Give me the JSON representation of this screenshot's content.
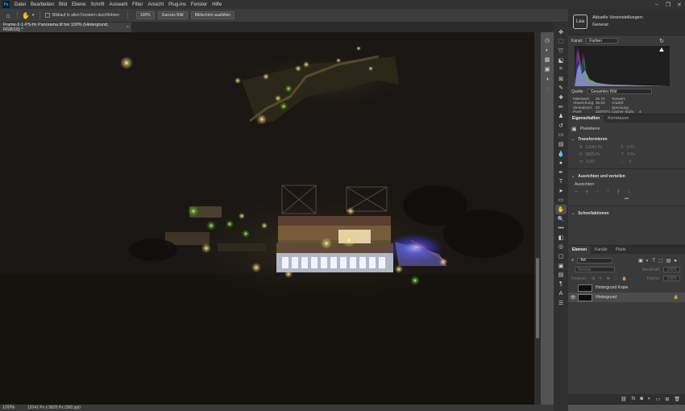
{
  "app": {
    "logo": "Ps"
  },
  "menu": [
    "Datei",
    "Bearbeiten",
    "Bild",
    "Ebene",
    "Schrift",
    "Auswahl",
    "Filter",
    "Ansicht",
    "Plug-ins",
    "Fenster",
    "Hilfe"
  ],
  "window_controls": [
    "–",
    "❐",
    "✕"
  ],
  "options": {
    "scroll_all_label": "Bildlauf in allen Fenstern durchführen",
    "zoom_btn": "100%",
    "fit_btn": "Ganzes Bild",
    "fill_btn": "Bildschirm ausfüllen"
  },
  "document_tab": {
    "title": "Frame-2-1-PS-fin Panorama.tif bei 100% (Hintergrund, RGB/16) *",
    "close": "×"
  },
  "status": {
    "zoom": "100%",
    "info": "12041 Px x 5825 Px (300 ppi)"
  },
  "learn_panel": {
    "line1": "Aktuelle Voreinstellungen:",
    "line2": "General",
    "icon": "Lea"
  },
  "histogram": {
    "kanal_label": "Kanal:",
    "kanal_value": "Farben",
    "quelle_label": "Quelle:",
    "quelle_value": "Gesamtes Bild",
    "stats": [
      [
        "Mittelwert:",
        "30.70",
        "Tonwert:",
        ""
      ],
      [
        "Abweichung:",
        "35.63",
        "Anzahl:",
        ""
      ],
      [
        "Zentralwert:",
        "24",
        "Spreizung:",
        ""
      ],
      [
        "Pixel:",
        "3297974",
        "Cacher-Stufe:",
        "4"
      ]
    ]
  },
  "properties": {
    "tabs": [
      "Eigenschaften",
      "Korrekturen"
    ],
    "pixel_layer": "Pixelebene",
    "transform": "Transformieren",
    "w_label": "B",
    "w_val": "12041 Px",
    "x_label": "X",
    "x_val": "0 Px",
    "h_label": "H",
    "h_val": "5825 Px",
    "y_label": "Y",
    "y_val": "0 Px",
    "angle": "0,00°",
    "align": "Ausrichten und verteilen",
    "align_sub": "Ausrichten:",
    "more": "•••",
    "quick": "Schnellaktionen"
  },
  "layers": {
    "tabs": [
      "Ebenen",
      "Kanäle",
      "Pfade"
    ],
    "filter_kind": "Art",
    "blend": "Normal",
    "opacity_label": "Deckkraft:",
    "opacity": "100%",
    "lock_label": "Fixieren:",
    "fill_label": "Fläche:",
    "fill": "100%",
    "items": [
      {
        "name": "Hintergrund Kopie",
        "selected": false
      },
      {
        "name": "Hintergrund",
        "selected": true
      }
    ]
  },
  "colors": {
    "accent": "#31a8ff",
    "bg": "#535353",
    "panel": "#3a3a3a"
  }
}
